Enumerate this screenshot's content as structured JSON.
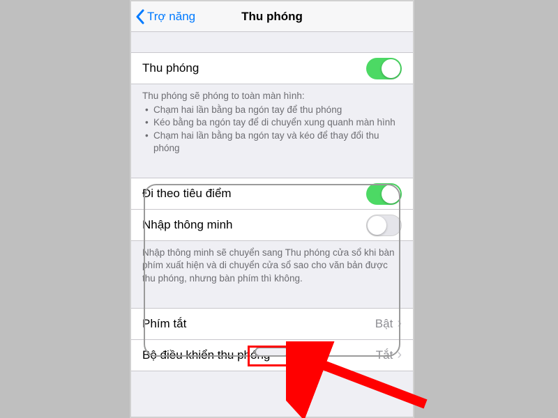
{
  "nav": {
    "back": "Trợ năng",
    "title": "Thu phóng"
  },
  "rows": {
    "zoom": "Thu phóng",
    "follow_focus": "Đi theo tiêu điểm",
    "smart_typing": "Nhập thông minh",
    "shortcut": {
      "label": "Phím tắt",
      "value": "Bật"
    },
    "controller": {
      "label": "Bộ điều khiển thu phóng",
      "value": "Tắt"
    }
  },
  "desc1": {
    "intro": "Thu phóng sẽ phóng to toàn màn hình:",
    "b1": "Chạm hai lần bằng ba ngón tay để thu phóng",
    "b2": "Kéo bằng ba ngón tay để di chuyển xung quanh màn hình",
    "b3": "Chạm hai lần bằng ba ngón tay và kéo để thay đổi thu phóng"
  },
  "desc2": "Nhập thông minh sẽ chuyển sang Thu phóng cửa sổ khi bàn phím xuất hiện và di chuyển cửa sổ sao cho văn bản được thu phóng, nhưng bàn phím thì không."
}
